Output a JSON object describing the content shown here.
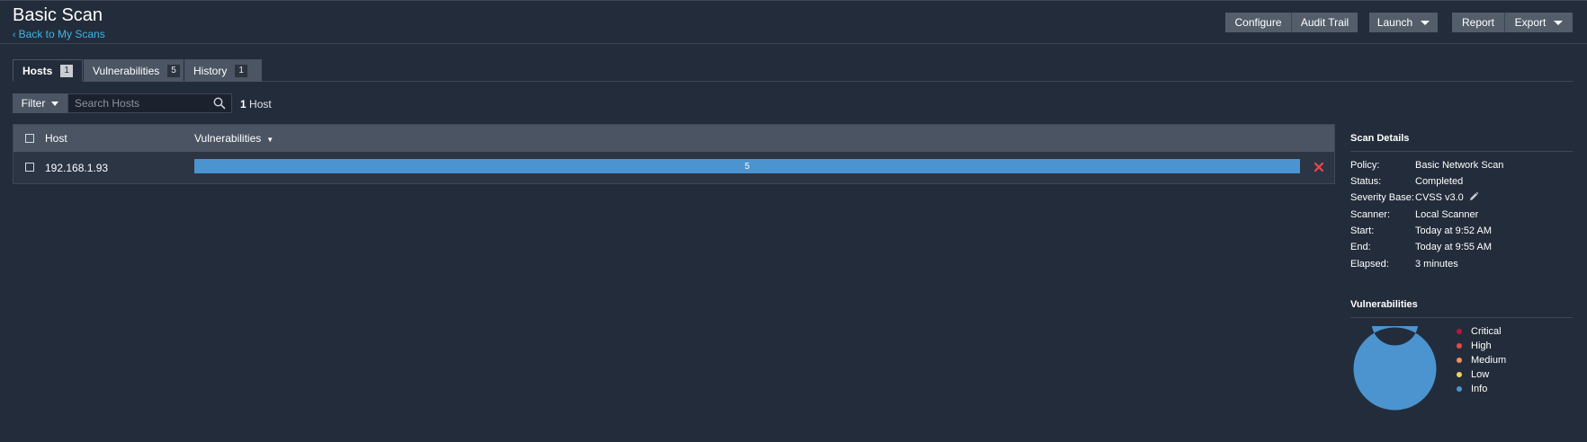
{
  "header": {
    "title": "Basic Scan",
    "back_link": "Back to My Scans",
    "buttons": {
      "configure": "Configure",
      "audit_trail": "Audit Trail",
      "launch": "Launch",
      "report": "Report",
      "export": "Export"
    }
  },
  "tabs": [
    {
      "label": "Hosts",
      "count": "1",
      "active": true
    },
    {
      "label": "Vulnerabilities",
      "count": "5",
      "active": false
    },
    {
      "label": "History",
      "count": "1",
      "active": false
    }
  ],
  "filter": {
    "label": "Filter",
    "search_placeholder": "Search Hosts",
    "host_count_number": "1",
    "host_count_label": "Host"
  },
  "table": {
    "columns": [
      "Host",
      "Vulnerabilities"
    ],
    "rows": [
      {
        "host": "192.168.1.93",
        "vulnerabilities": "5",
        "info_fraction": 1.0
      }
    ]
  },
  "scan_details": {
    "title": "Scan Details",
    "items": [
      {
        "label": "Policy:",
        "value": "Basic Network Scan"
      },
      {
        "label": "Status:",
        "value": "Completed"
      },
      {
        "label": "Severity Base:",
        "value": "CVSS v3.0"
      },
      {
        "label": "Scanner:",
        "value": "Local Scanner"
      },
      {
        "label": "Start:",
        "value": "Today at 9:52 AM"
      },
      {
        "label": "End:",
        "value": "Today at 9:55 AM"
      },
      {
        "label": "Elapsed:",
        "value": "3 minutes"
      }
    ]
  },
  "vulnerabilities_chart": {
    "title": "Vulnerabilities",
    "legend": [
      {
        "label": "Critical",
        "color": "#b8163c"
      },
      {
        "label": "High",
        "color": "#e8484b"
      },
      {
        "label": "Medium",
        "color": "#f28f5c"
      },
      {
        "label": "Low",
        "color": "#f3d35c"
      },
      {
        "label": "Info",
        "color": "#4b94cf"
      }
    ]
  },
  "chart_data": {
    "type": "pie",
    "categories": [
      "Critical",
      "High",
      "Medium",
      "Low",
      "Info"
    ],
    "values": [
      0,
      0,
      0,
      0,
      5
    ],
    "title": "Vulnerabilities"
  }
}
